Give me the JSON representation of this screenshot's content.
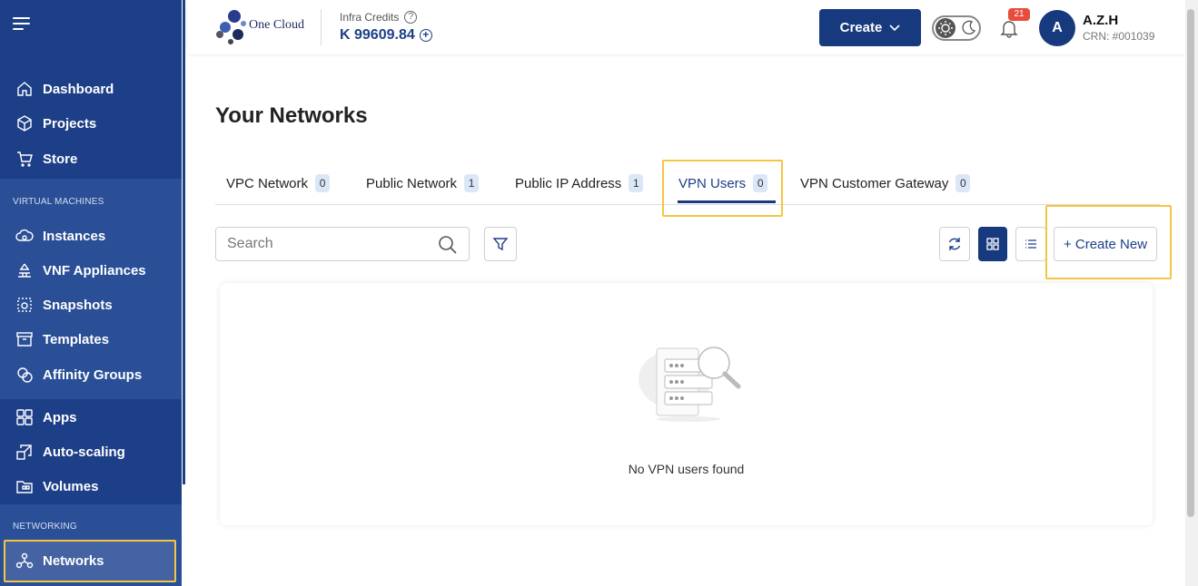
{
  "app": {
    "brand_name": "One Cloud",
    "logo_subtext": "",
    "infra_credits_label": "Infra Credits",
    "infra_credits_value": "K 99609.84",
    "create_label": "Create",
    "notification_count": "21",
    "user": {
      "initial": "A",
      "name": "A.Z.H",
      "crn": "CRN: #001039"
    }
  },
  "sidebar": {
    "top_items": [
      {
        "label": "Dashboard",
        "icon": "home-icon"
      },
      {
        "label": "Projects",
        "icon": "cube-icon"
      },
      {
        "label": "Store",
        "icon": "cart-icon"
      }
    ],
    "sections": [
      {
        "title": "VIRTUAL MACHINES",
        "items": [
          {
            "label": "Instances",
            "icon": "cloud-icon"
          },
          {
            "label": "VNF Appliances",
            "icon": "firewall-icon"
          },
          {
            "label": "Snapshots",
            "icon": "snapshot-icon"
          },
          {
            "label": "Templates",
            "icon": "archive-icon"
          },
          {
            "label": "Affinity Groups",
            "icon": "affinity-icon"
          }
        ]
      },
      {
        "title": "",
        "items": [
          {
            "label": "Apps",
            "icon": "apps-icon"
          },
          {
            "label": "Auto-scaling",
            "icon": "autoscale-icon"
          },
          {
            "label": "Volumes",
            "icon": "volumes-icon"
          }
        ]
      },
      {
        "title": "NETWORKING",
        "items": [
          {
            "label": "Networks",
            "icon": "network-icon",
            "active": true
          }
        ]
      }
    ]
  },
  "main": {
    "title": "Your Networks",
    "tabs": [
      {
        "label": "VPC Network",
        "count": "0"
      },
      {
        "label": "Public Network",
        "count": "1"
      },
      {
        "label": "Public IP Address",
        "count": "1"
      },
      {
        "label": "VPN Users",
        "count": "0",
        "active": true
      },
      {
        "label": "VPN Customer Gateway",
        "count": "0"
      }
    ],
    "search_placeholder": "Search",
    "create_new_label": "+ Create New",
    "empty_message": "No VPN users found"
  },
  "colors": {
    "sidebar_bg": "#1d3f87",
    "primary": "#17397e",
    "highlight": "#f5c542",
    "badge": "#e74c3c"
  }
}
